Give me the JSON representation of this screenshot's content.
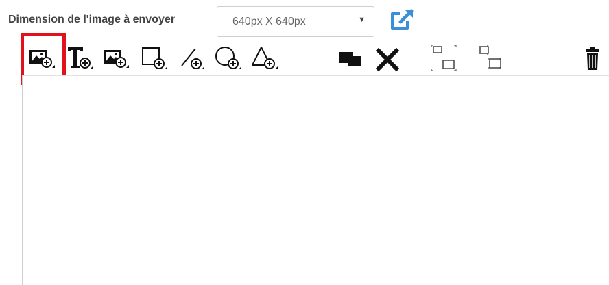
{
  "dimension": {
    "label": "Dimension de l'image à envoyer",
    "selected_value": "640px X 640px"
  },
  "icons": {
    "external_link": "external-link-icon",
    "caret": "caret-down-icon"
  },
  "toolbar": {
    "tools": [
      {
        "name": "add-image-tool",
        "icon": "image-plus-icon",
        "highlighted": true
      },
      {
        "name": "add-text-tool",
        "icon": "text-plus-icon"
      },
      {
        "name": "add-image-tool-2",
        "icon": "image-plus-icon"
      },
      {
        "name": "add-rectangle-tool",
        "icon": "rectangle-plus-icon"
      },
      {
        "name": "add-line-tool",
        "icon": "line-plus-icon"
      },
      {
        "name": "add-circle-tool",
        "icon": "circle-plus-icon"
      },
      {
        "name": "add-triangle-tool",
        "icon": "triangle-plus-icon"
      },
      {
        "name": "bring-to-front-tool",
        "icon": "layers-icon"
      },
      {
        "name": "delete-selection-tool",
        "icon": "close-icon"
      },
      {
        "name": "group-tool",
        "icon": "group-icon"
      },
      {
        "name": "ungroup-tool",
        "icon": "ungroup-icon"
      },
      {
        "name": "trash-tool",
        "icon": "trash-icon"
      }
    ]
  },
  "colors": {
    "highlight": "#e0121b",
    "link_blue": "#3b8fd6",
    "icon": "#111111"
  }
}
